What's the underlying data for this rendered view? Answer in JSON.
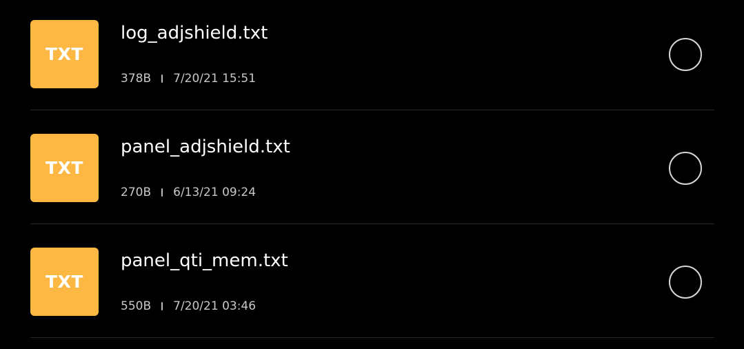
{
  "files": [
    {
      "icon_label": "TXT",
      "name": "log_adjshield.txt",
      "size": "378B",
      "modified": "7/20/21 15:51"
    },
    {
      "icon_label": "TXT",
      "name": "panel_adjshield.txt",
      "size": "270B",
      "modified": "6/13/21 09:24"
    },
    {
      "icon_label": "TXT",
      "name": "panel_qti_mem.txt",
      "size": "550B",
      "modified": "7/20/21 03:46"
    }
  ],
  "colors": {
    "background": "#000000",
    "txt_icon": "#FDB743",
    "divider": "#2a2a2a"
  },
  "icons": {
    "file_type": "txt-file-icon",
    "select": "radio-circle-icon"
  }
}
